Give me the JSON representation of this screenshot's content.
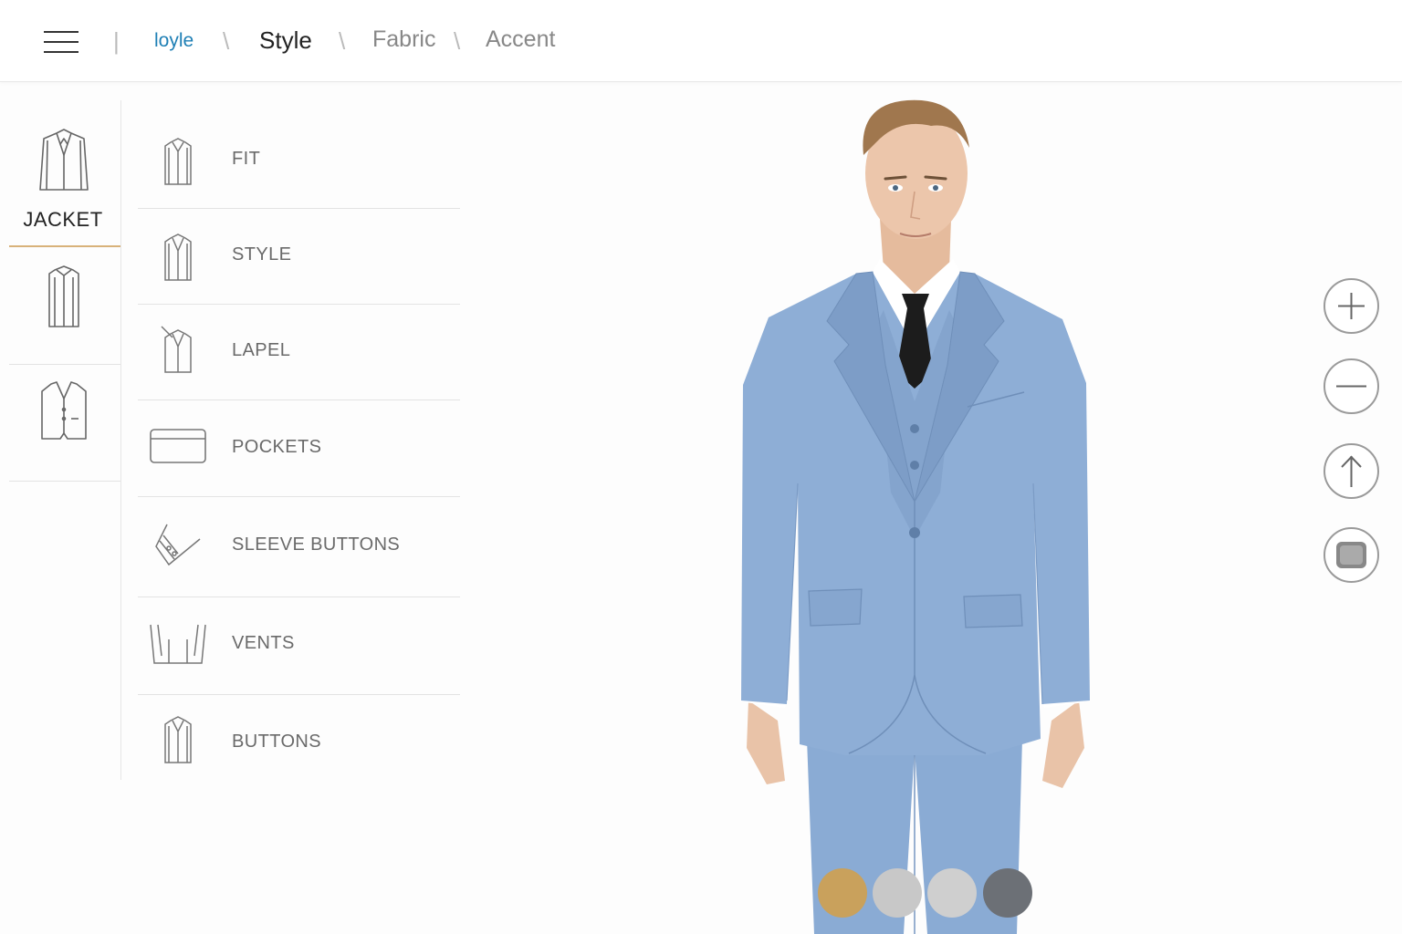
{
  "breadcrumb": {
    "brand": "loyle",
    "active": "Style",
    "items": [
      "Fabric",
      "Accent"
    ]
  },
  "categories": [
    {
      "name": "jacket",
      "label": "JACKET",
      "active": true
    },
    {
      "name": "shirt",
      "label": ""
    },
    {
      "name": "vest",
      "label": ""
    }
  ],
  "options": [
    {
      "label": "FIT",
      "icon": "jacket-outline-icon"
    },
    {
      "label": "STYLE",
      "icon": "jacket-outline-icon"
    },
    {
      "label": "LAPEL",
      "icon": "lapel-icon"
    },
    {
      "label": "POCKETS",
      "icon": "pocket-icon"
    },
    {
      "label": "SLEEVE BUTTONS",
      "icon": "sleeve-buttons-icon"
    },
    {
      "label": "VENTS",
      "icon": "vents-icon"
    },
    {
      "label": "BUTTONS",
      "icon": "jacket-outline-icon"
    }
  ],
  "tools": [
    "zoom-in",
    "zoom-out",
    "rotate",
    "fabric-view"
  ],
  "swatches": [
    {
      "name": "camel",
      "color": "#c9a15c"
    },
    {
      "name": "light-grey",
      "color": "#c8c8c8"
    },
    {
      "name": "silver",
      "color": "#cfcfcf"
    },
    {
      "name": "charcoal",
      "color": "#6c7076"
    }
  ],
  "colors": {
    "accent": "#d8b27a",
    "brand": "#1e7fb5",
    "suit": "#8eaed6"
  }
}
